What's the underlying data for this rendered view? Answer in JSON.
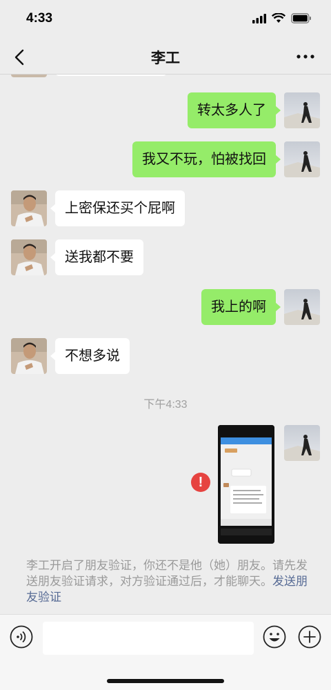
{
  "status_bar": {
    "time": "4:33"
  },
  "nav": {
    "title": "李工"
  },
  "messages": [
    {
      "from": "me",
      "text": "转太多人了"
    },
    {
      "from": "me",
      "text": "我又不玩，怕被找回"
    },
    {
      "from": "them",
      "text": "上密保还买个屁啊"
    },
    {
      "from": "them",
      "text": "送我都不要"
    },
    {
      "from": "me",
      "text": "我上的啊"
    },
    {
      "from": "them",
      "text": "不想多说"
    }
  ],
  "timestamp": "下午4:33",
  "image_message": {
    "status": "failed"
  },
  "system_notice": {
    "text": "李工开启了朋友验证，你还不是他（她）朋友。请先发送朋友验证请求，对方验证通过后，才能聊天。",
    "link": "发送朋友验证"
  },
  "icons": {
    "back": "chevron-left-icon",
    "more": "more-dots-icon",
    "voice": "voice-icon",
    "emoji": "emoji-icon",
    "plus": "plus-icon",
    "error": "error-icon"
  },
  "colors": {
    "my_bubble": "#95ec69",
    "their_bubble": "#ffffff",
    "link": "#576b95",
    "error": "#e64340"
  }
}
